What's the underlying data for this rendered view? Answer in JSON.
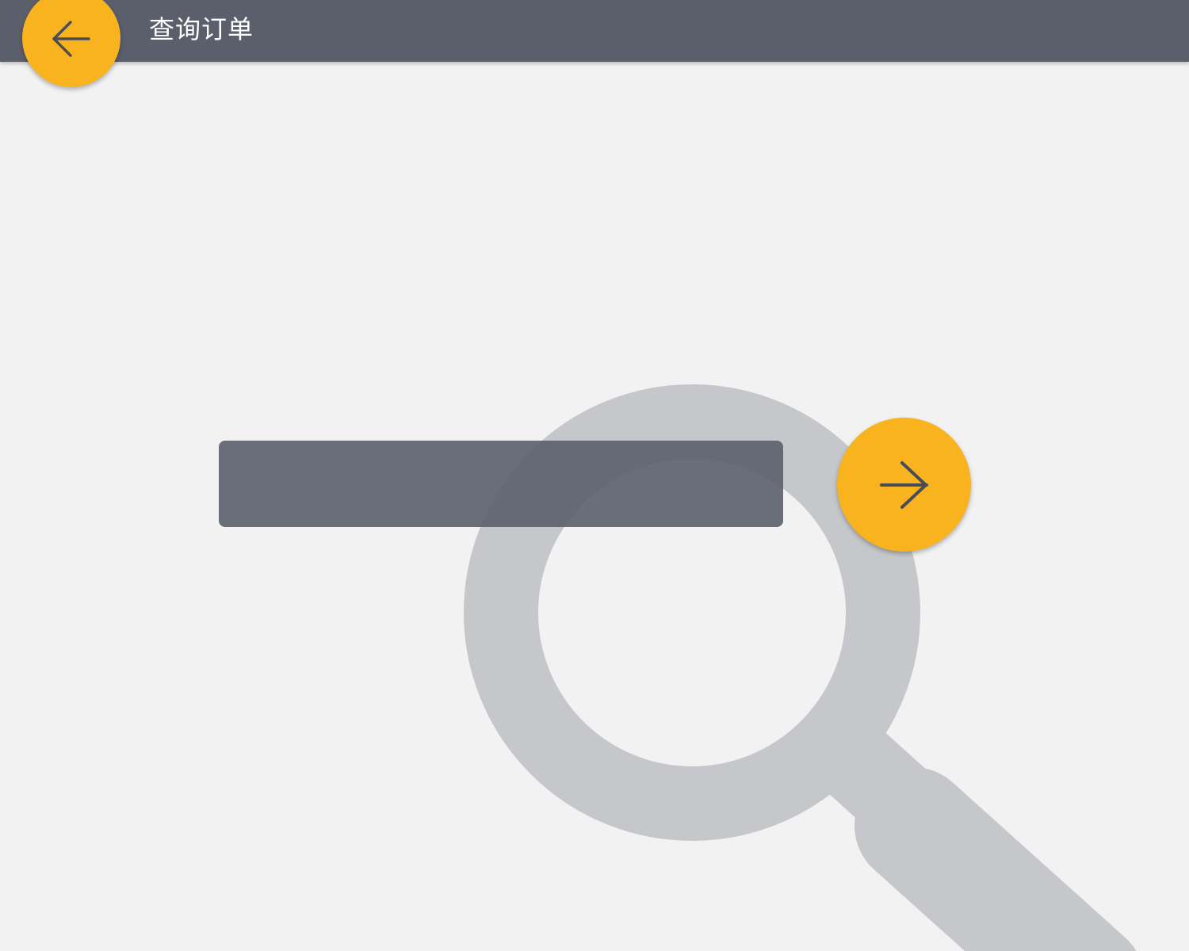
{
  "header": {
    "title": "查询订单",
    "background_color": "#5a5f6b",
    "back_button": {
      "icon": "arrow-left-icon",
      "color": "#f9b31f"
    }
  },
  "search": {
    "value": "",
    "placeholder": "",
    "submit_button": {
      "icon": "arrow-right-icon",
      "color": "#f9b31f"
    }
  },
  "background": {
    "color": "#f2f2f2",
    "watermark_icon": "magnifier-icon",
    "watermark_color": "#c6c7ca"
  }
}
